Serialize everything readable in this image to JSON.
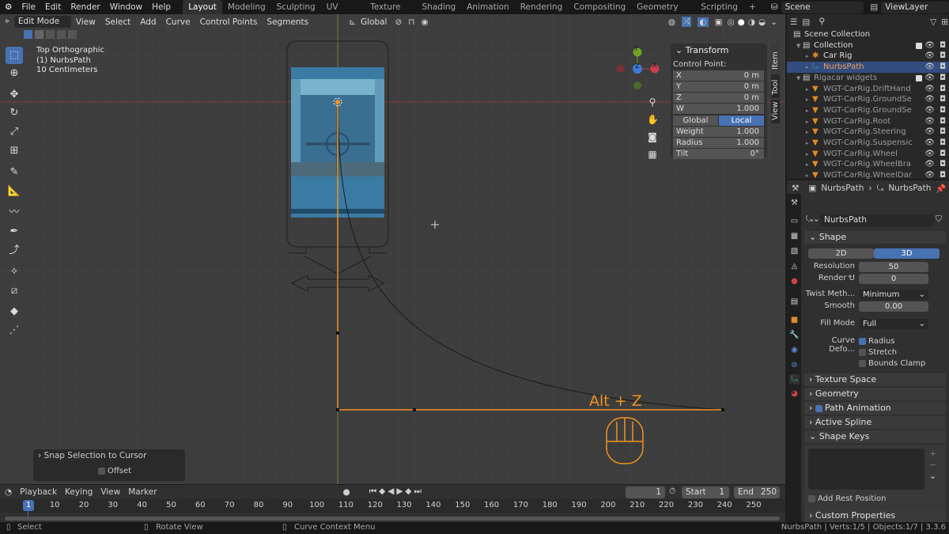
{
  "topbar": {
    "menus": [
      "File",
      "Edit",
      "Render",
      "Window",
      "Help"
    ],
    "workspaces": [
      "Layout",
      "Modeling",
      "Sculpting",
      "UV Editing",
      "Texture Paint",
      "Shading",
      "Animation",
      "Rendering",
      "Compositing",
      "Geometry Nodes",
      "Scripting",
      "+"
    ],
    "active_workspace": "Layout",
    "scene": "Scene",
    "view_layer": "ViewLayer"
  },
  "viewport_header": {
    "mode": "Edit Mode",
    "menus": [
      "View",
      "Select",
      "Add",
      "Curve",
      "Control Points",
      "Segments"
    ],
    "orientation": "Global"
  },
  "viewport": {
    "overlay_lines": [
      "Top Orthographic",
      "(1) NurbsPath",
      "10 Centimeters"
    ],
    "hint": "Alt + Z",
    "accent": "#f0931e",
    "gizmo": {
      "x": "X",
      "y": "Y",
      "z": "Z"
    }
  },
  "npanel": {
    "title": "Transform",
    "subtitle": "Control Point:",
    "rows": [
      {
        "label": "X",
        "value": "0 m"
      },
      {
        "label": "Y",
        "value": "0 m"
      },
      {
        "label": "Z",
        "value": "0 m"
      },
      {
        "label": "W",
        "value": "1.000"
      }
    ],
    "space": [
      "Global",
      "Local"
    ],
    "active_space": "Local",
    "rows2": [
      {
        "label": "Weight",
        "value": "1.000"
      },
      {
        "label": "Radius",
        "value": "1.000"
      },
      {
        "label": "Tilt",
        "value": "0°"
      }
    ],
    "tabs": [
      "Item",
      "Tool",
      "View"
    ]
  },
  "operator_panel": {
    "title": "Snap Selection to Cursor",
    "option": "Offset",
    "option_checked": false
  },
  "outliner": {
    "items": [
      {
        "label": "Scene Collection",
        "depth": 0
      },
      {
        "label": "Collection",
        "depth": 1
      },
      {
        "label": "Car Rig",
        "depth": 2
      },
      {
        "label": "NurbsPath",
        "depth": 2,
        "selected": true
      },
      {
        "label": "Rigacar widgets",
        "depth": 1
      },
      {
        "label": "WGT-CarRig.DriftHand",
        "depth": 2
      },
      {
        "label": "WGT-CarRig.GroundSe",
        "depth": 2
      },
      {
        "label": "WGT-CarRig.GroundSe",
        "depth": 2
      },
      {
        "label": "WGT-CarRig.Root",
        "depth": 2
      },
      {
        "label": "WGT-CarRig.Steering",
        "depth": 2
      },
      {
        "label": "WGT-CarRig.Suspensic",
        "depth": 2
      },
      {
        "label": "WGT-CarRig.Wheel",
        "depth": 2
      },
      {
        "label": "WGT-CarRig.WheelBra",
        "depth": 2
      },
      {
        "label": "WGT-CarRig.WheelDar",
        "depth": 2
      }
    ]
  },
  "properties": {
    "breadcrumb": [
      "NurbsPath",
      "NurbsPath"
    ],
    "datablock": "NurbsPath",
    "shape": {
      "title": "Shape",
      "dims": [
        "2D",
        "3D"
      ],
      "active_dim": "3D",
      "resolution_label": "Resolution ...",
      "resolution": "50",
      "render_u_label": "Render U",
      "render_u": "0",
      "twist_label": "Twist Meth...",
      "twist": "Minimum",
      "smooth_label": "Smooth",
      "smooth": "0.00",
      "fill_label": "Fill Mode",
      "fill": "Full",
      "deform_label": "Curve Defo...",
      "deform_opts": [
        {
          "label": "Radius",
          "checked": true
        },
        {
          "label": "Stretch",
          "checked": false
        },
        {
          "label": "Bounds Clamp",
          "checked": false
        }
      ]
    },
    "sections": [
      "Texture Space",
      "Geometry",
      "Path Animation",
      "Active Spline",
      "Shape Keys"
    ],
    "add_rest": "Add Rest Position",
    "custom": "Custom Properties"
  },
  "timeline": {
    "menus": [
      "Playback",
      "Keying",
      "View",
      "Marker"
    ],
    "current_frame": "1",
    "start_label": "Start",
    "start": "1",
    "end_label": "End",
    "end": "250",
    "ticks": [
      "10",
      "20",
      "30",
      "40",
      "50",
      "60",
      "70",
      "80",
      "90",
      "100",
      "110",
      "120",
      "130",
      "140",
      "150",
      "160",
      "170",
      "180",
      "190",
      "200",
      "210",
      "220",
      "230",
      "240",
      "250"
    ],
    "playhead": "1"
  },
  "statusbar": {
    "hints": [
      "Select",
      "Rotate View",
      "Curve Context Menu"
    ],
    "info": "NurbsPath | Verts:1/5 | Objects:1/7 | 3.3.6"
  }
}
